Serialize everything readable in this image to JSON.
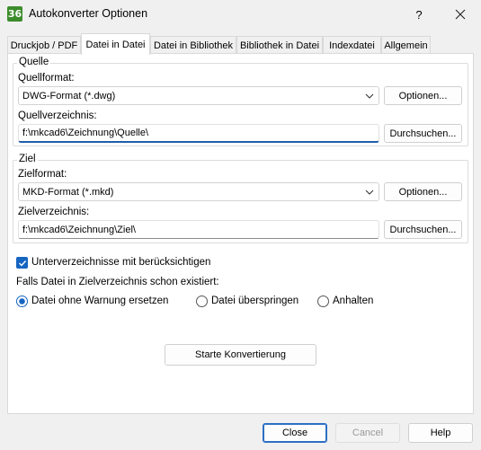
{
  "window": {
    "title": "Autokonverter Optionen",
    "app_icon_text": "36",
    "help_label": "?"
  },
  "tabs": [
    {
      "label": "Druckjob / PDF"
    },
    {
      "label": "Datei in Datei",
      "active": true
    },
    {
      "label": "Datei in Bibliothek"
    },
    {
      "label": "Bibliothek in Datei"
    },
    {
      "label": "Indexdatei"
    },
    {
      "label": "Allgemein"
    }
  ],
  "source": {
    "group_label": "Quelle",
    "format_label": "Quellformat:",
    "format_value": "DWG-Format (*.dwg)",
    "options_button": "Optionen...",
    "dir_label": "Quellverzeichnis:",
    "dir_value": "f:\\mkcad6\\Zeichnung\\Quelle\\",
    "browse_button": "Durchsuchen..."
  },
  "target": {
    "group_label": "Ziel",
    "format_label": "Zielformat:",
    "format_value": "MKD-Format (*.mkd)",
    "options_button": "Optionen...",
    "dir_label": "Zielverzeichnis:",
    "dir_value": "f:\\mkcad6\\Zeichnung\\Ziel\\",
    "browse_button": "Durchsuchen..."
  },
  "subdirs_checkbox": {
    "label": "Unterverzeichnisse mit berücksichtigen",
    "checked": true
  },
  "exists_label": "Falls Datei in Zielverzeichnis schon existiert:",
  "exists_options": [
    {
      "label": "Datei ohne Warnung ersetzen",
      "selected": true
    },
    {
      "label": "Datei überspringen",
      "selected": false
    },
    {
      "label": "Anhalten",
      "selected": false
    }
  ],
  "start_button": "Starte Konvertierung",
  "footer": {
    "close": "Close",
    "cancel": "Cancel",
    "help": "Help"
  },
  "colors": {
    "accent": "#1665c1",
    "app_icon": "#3c8c2c"
  }
}
